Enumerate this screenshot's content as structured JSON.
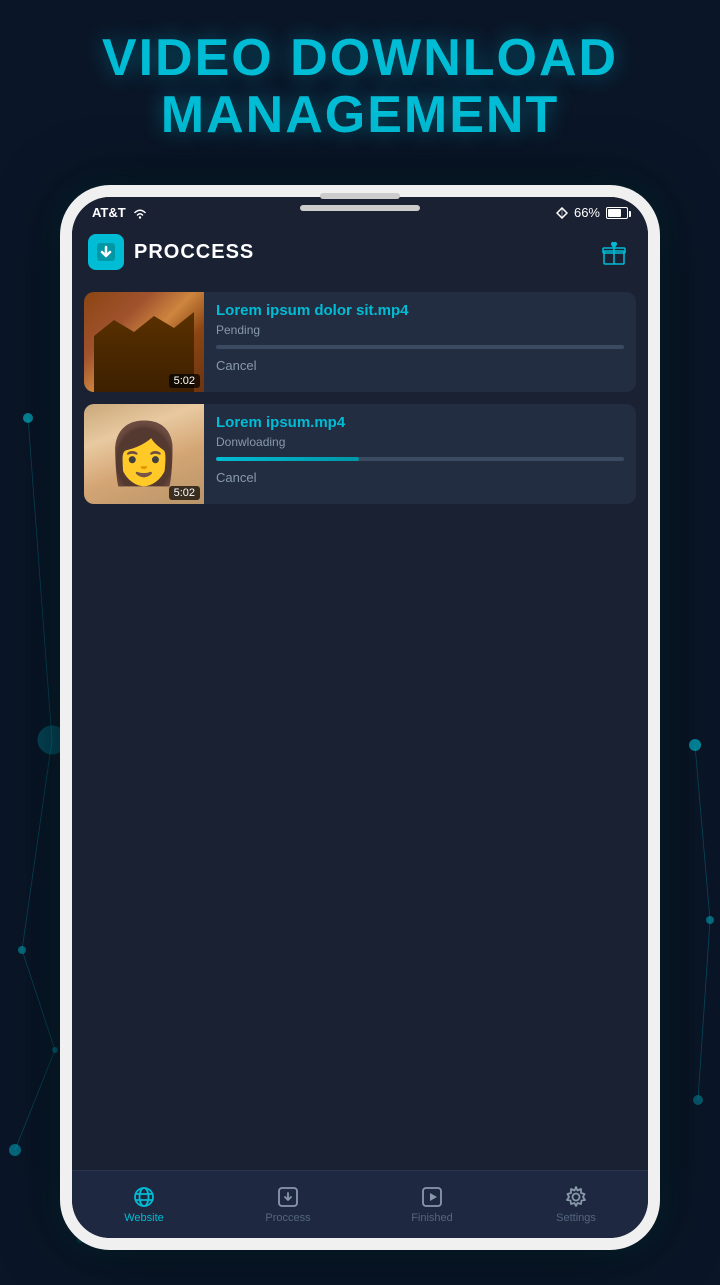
{
  "page": {
    "title_line1": "VIDEO DOWNLOAD",
    "title_line2": "MANAGEMENT"
  },
  "status_bar": {
    "carrier": "AT&T",
    "signal": "wifi",
    "direction_icon": "arrow",
    "battery": "66%"
  },
  "app_header": {
    "title": "PROCCESS",
    "gift_icon": "gift"
  },
  "downloads": [
    {
      "filename": "Lorem ipsum dolor sit.mp4",
      "status": "Pending",
      "duration": "5:02",
      "progress": 0,
      "cancel_label": "Cancel",
      "thumb_type": "canyon"
    },
    {
      "filename": "Lorem ipsum.mp4",
      "status": "Donwloading",
      "duration": "5:02",
      "progress": 35,
      "cancel_label": "Cancel",
      "thumb_type": "person"
    }
  ],
  "bottom_nav": {
    "items": [
      {
        "id": "website",
        "label": "Website",
        "icon": "globe",
        "active": false
      },
      {
        "id": "proccess",
        "label": "Proccess",
        "icon": "download",
        "active": true
      },
      {
        "id": "finished",
        "label": "Finished",
        "icon": "play-square",
        "active": false
      },
      {
        "id": "settings",
        "label": "Settings",
        "icon": "gear",
        "active": false
      }
    ]
  },
  "colors": {
    "accent": "#00bcd4",
    "background": "#0a1628",
    "screen_bg": "#1a2133",
    "card_bg": "#232d42",
    "nav_bg": "#1e2840",
    "text_primary": "#ffffff",
    "text_secondary": "#8899aa"
  }
}
